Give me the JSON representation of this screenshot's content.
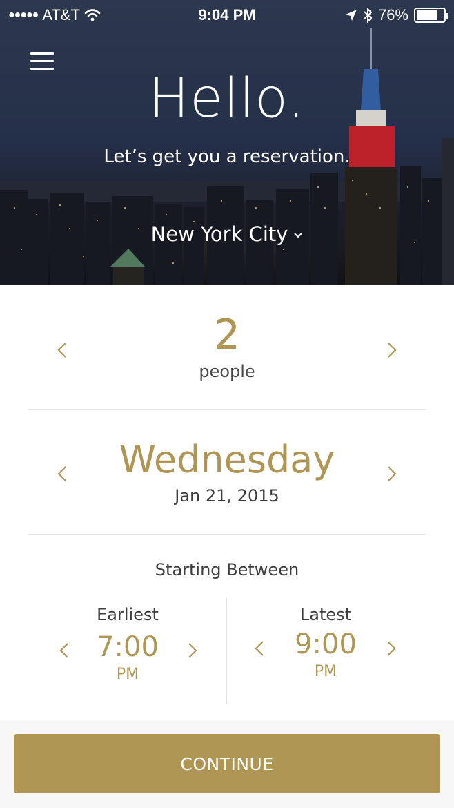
{
  "status_bar": {
    "signal": "●●●●●",
    "carrier": "AT&T",
    "wifi_icon": "wifi-icon",
    "time": "9:04 PM",
    "location_icon": "location-arrow-icon",
    "bluetooth_icon": "bluetooth-icon",
    "battery": "76%"
  },
  "hero": {
    "menu_icon": "hamburger-menu-icon",
    "title": "Hello.",
    "subtitle": "Let’s get you a reservation.",
    "city": "New York City"
  },
  "party": {
    "count": "2",
    "label": "people"
  },
  "date": {
    "day": "Wednesday",
    "full": "Jan 21, 2015"
  },
  "time_range": {
    "heading": "Starting Between",
    "earliest": {
      "label": "Earliest",
      "time": "7:00",
      "period": "PM"
    },
    "latest": {
      "label": "Latest",
      "time": "9:00",
      "period": "PM"
    }
  },
  "footer": {
    "continue_label": "CONTINUE"
  },
  "colors": {
    "accent": "#b09655",
    "text": "#3d3d3d",
    "divider": "#e3e3e3"
  }
}
